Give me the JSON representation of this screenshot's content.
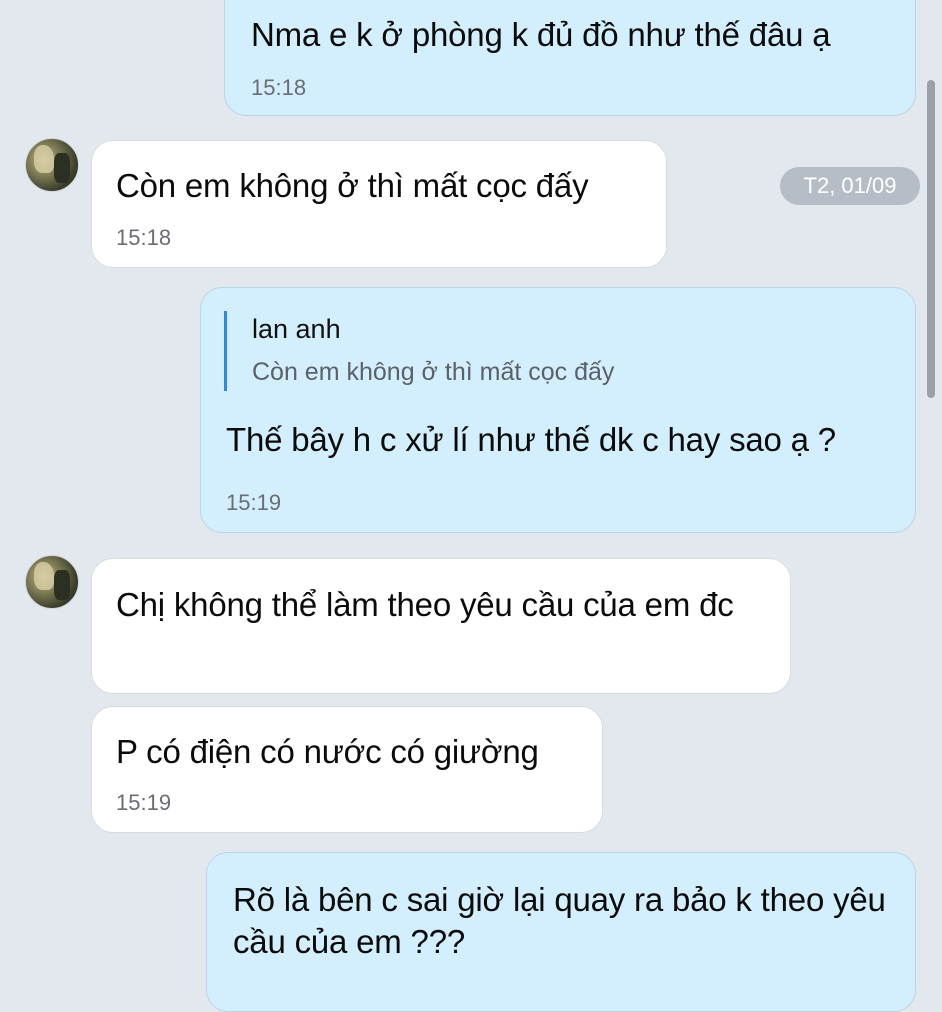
{
  "messages": [
    {
      "id": "m1",
      "direction": "sent",
      "text": "Nma e k ở phòng k đủ đồ như thế đâu ạ",
      "time": "15:18"
    },
    {
      "id": "m2",
      "direction": "received",
      "text": "Còn em không ở thì mất cọc đấy",
      "time": "15:18"
    },
    {
      "id": "m3",
      "direction": "sent",
      "reply_to": {
        "author": "lan anh",
        "text": "Còn em không ở thì mất cọc đấy"
      },
      "text": "Thế bây h c xử lí như thế dk c hay sao ạ ?",
      "time": "15:19"
    },
    {
      "id": "m4",
      "direction": "received",
      "text": "Chị không thể làm theo yêu cầu của em đc"
    },
    {
      "id": "m5",
      "direction": "received",
      "text": "P có điện có nước có giường",
      "time": "15:19"
    },
    {
      "id": "m6",
      "direction": "sent",
      "text": "Rõ là bên c sai giờ lại quay ra bảo k theo yêu cầu của em ???"
    }
  ],
  "date_separator": "T2, 01/09",
  "icons": {
    "avatar": "contact-avatar-photo"
  },
  "colors": {
    "background": "#e3e8ef",
    "sent_bubble": "#d3eefc",
    "received_bubble": "#ffffff",
    "quote_accent": "#2d8bd8",
    "time_text": "#6a6e73"
  }
}
